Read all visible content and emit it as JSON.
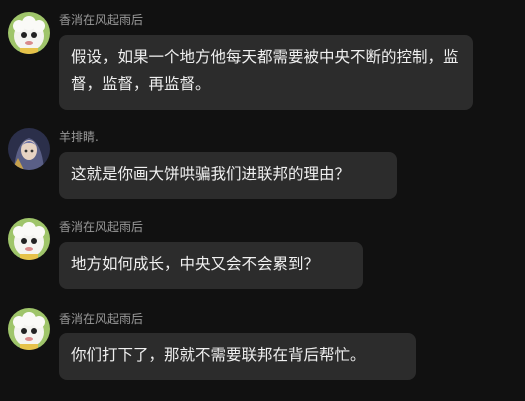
{
  "messages": [
    {
      "sender": "香消在风起雨后",
      "avatar_icon": "sheep-cartoon-avatar-icon",
      "text": "假设，如果一个地方他每天都需要被中央不断的控制，监督，监督，再监督。"
    },
    {
      "sender": "羊排睛.",
      "avatar_icon": "anime-character-avatar-icon",
      "text": "这就是你画大饼哄骗我们进联邦的理由？"
    },
    {
      "sender": "香消在风起雨后",
      "avatar_icon": "sheep-cartoon-avatar-icon",
      "text": "地方如何成长，中央又会不会累到？"
    },
    {
      "sender": "香消在风起雨后",
      "avatar_icon": "sheep-cartoon-avatar-icon",
      "text": "你们打下了，那就不需要联邦在背后帮忙。"
    }
  ],
  "colors": {
    "background": "#111111",
    "bubble": "#2c2c2c",
    "sender_name": "#9a9a9a",
    "message_text": "#f0f0f0"
  }
}
